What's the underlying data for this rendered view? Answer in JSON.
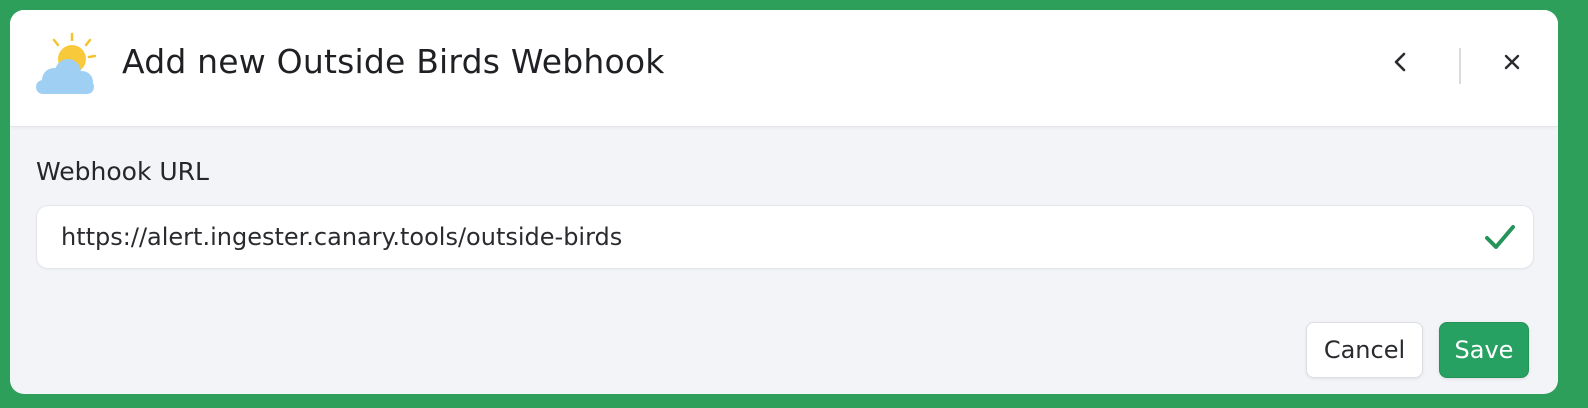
{
  "dialog": {
    "title": "Add new Outside Birds Webhook",
    "logo_icon": "sun-behind-cloud-icon",
    "back_icon": "chevron-left-icon",
    "close_icon": "close-icon"
  },
  "form": {
    "webhook_label": "Webhook URL",
    "webhook_value": "https://alert.ingester.canary.tools/outside-birds",
    "valid_icon": "checkmark-icon"
  },
  "actions": {
    "cancel_label": "Cancel",
    "save_label": "Save"
  },
  "colors": {
    "frame": "#2e9e5b",
    "save_button": "#27a162",
    "check": "#26935a"
  }
}
